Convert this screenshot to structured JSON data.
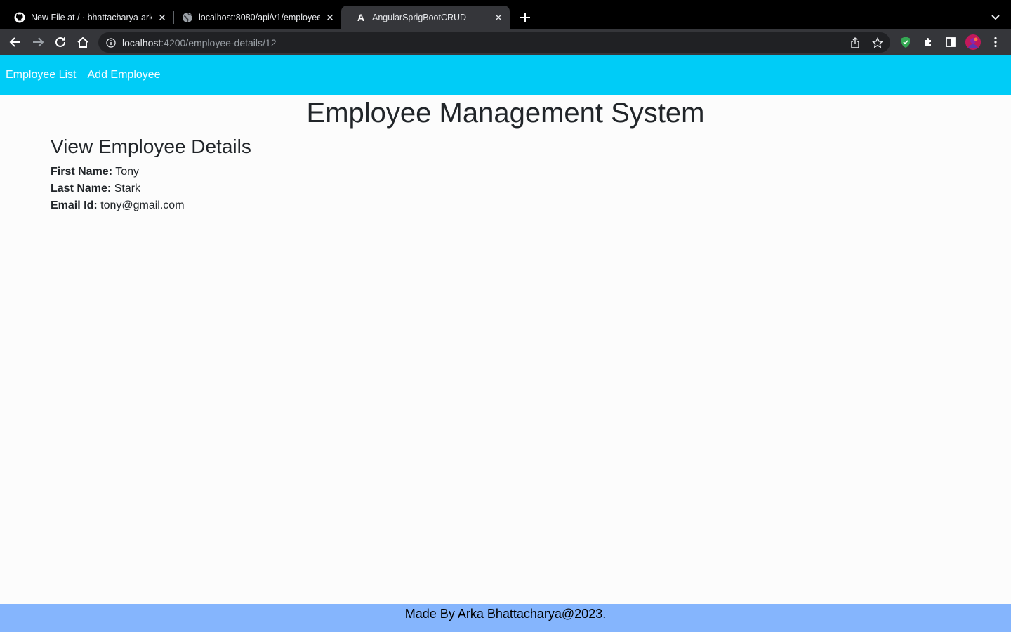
{
  "browser": {
    "tabs": [
      {
        "title": "New File at / · bhattacharya-ark",
        "favicon": "github-icon",
        "active": false
      },
      {
        "title": "localhost:8080/api/v1/employee",
        "favicon": "globe-icon",
        "active": false
      },
      {
        "title": "AngularSprigBootCRUD",
        "favicon": "angular-icon",
        "active": true
      }
    ],
    "address": {
      "host": "localhost",
      "path": ":4200/employee-details/12"
    },
    "icons": {
      "back": "back-arrow-icon",
      "forward": "forward-arrow-icon",
      "reload": "reload-icon",
      "home": "home-icon",
      "share": "share-icon",
      "bookmark": "star-icon",
      "extension_shield": "shield-icon",
      "extensions": "puzzle-icon",
      "side_panel": "side-panel-icon",
      "profile": "avatar",
      "menu": "kebab-menu-icon"
    }
  },
  "nav": {
    "items": [
      {
        "label": "Employee List"
      },
      {
        "label": "Add Employee"
      }
    ],
    "background": "#00ccf7"
  },
  "page": {
    "title": "Employee Management System",
    "section_title": "View Employee Details",
    "details": [
      {
        "label": "First Name:",
        "value": "Tony"
      },
      {
        "label": "Last Name:",
        "value": "Stark"
      },
      {
        "label": "Email Id:",
        "value": "tony@gmail.com"
      }
    ]
  },
  "footer": {
    "text": "Made By Arka Bhattacharya@2023.",
    "background": "#85b5fd"
  }
}
